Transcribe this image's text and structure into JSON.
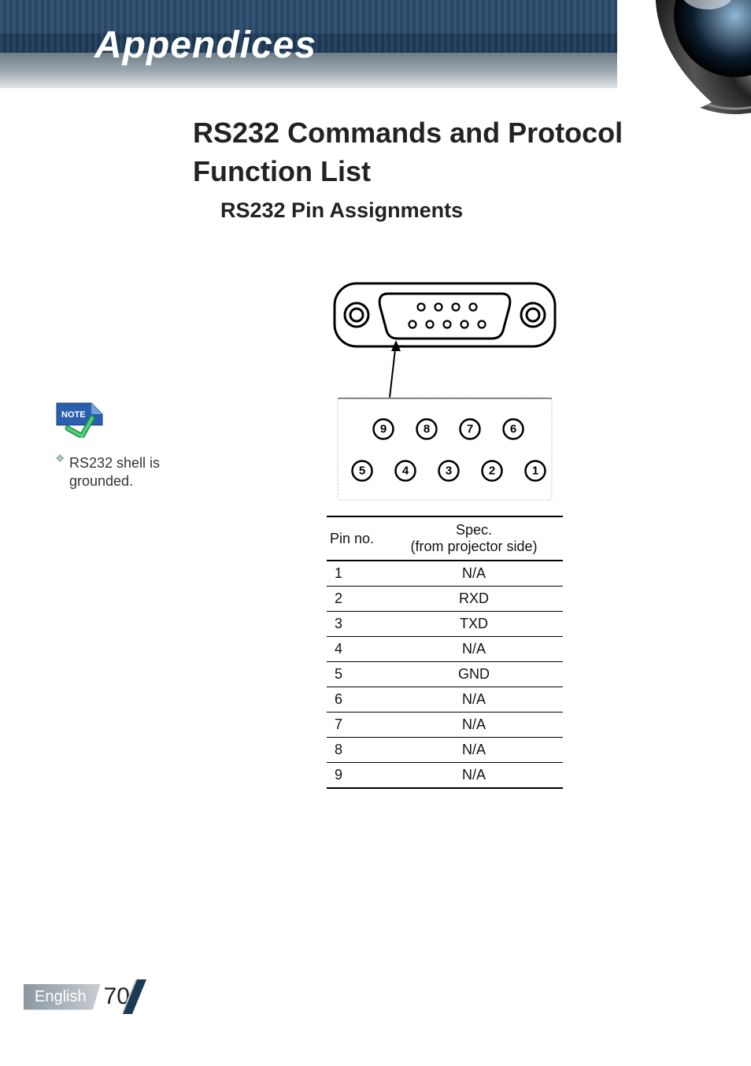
{
  "banner": {
    "title": "Appendices"
  },
  "page": {
    "title": "RS232 Commands and Protocol Function List",
    "subtitle": "RS232 Pin Assignments"
  },
  "note": {
    "tag": "NOTE",
    "text": "RS232 shell is grounded."
  },
  "diagram": {
    "pin_labels": [
      "9",
      "8",
      "7",
      "6",
      "5",
      "4",
      "3",
      "2",
      "1"
    ]
  },
  "table": {
    "header_pin": "Pin no.",
    "header_spec_top": "Spec.",
    "header_spec_bottom": "(from projector side)",
    "rows": [
      {
        "pin": "1",
        "spec": "N/A"
      },
      {
        "pin": "2",
        "spec": "RXD"
      },
      {
        "pin": "3",
        "spec": "TXD"
      },
      {
        "pin": "4",
        "spec": "N/A"
      },
      {
        "pin": "5",
        "spec": "GND"
      },
      {
        "pin": "6",
        "spec": "N/A"
      },
      {
        "pin": "7",
        "spec": "N/A"
      },
      {
        "pin": "8",
        "spec": "N/A"
      },
      {
        "pin": "9",
        "spec": "N/A"
      }
    ]
  },
  "footer": {
    "language": "English",
    "page_number": "70"
  }
}
